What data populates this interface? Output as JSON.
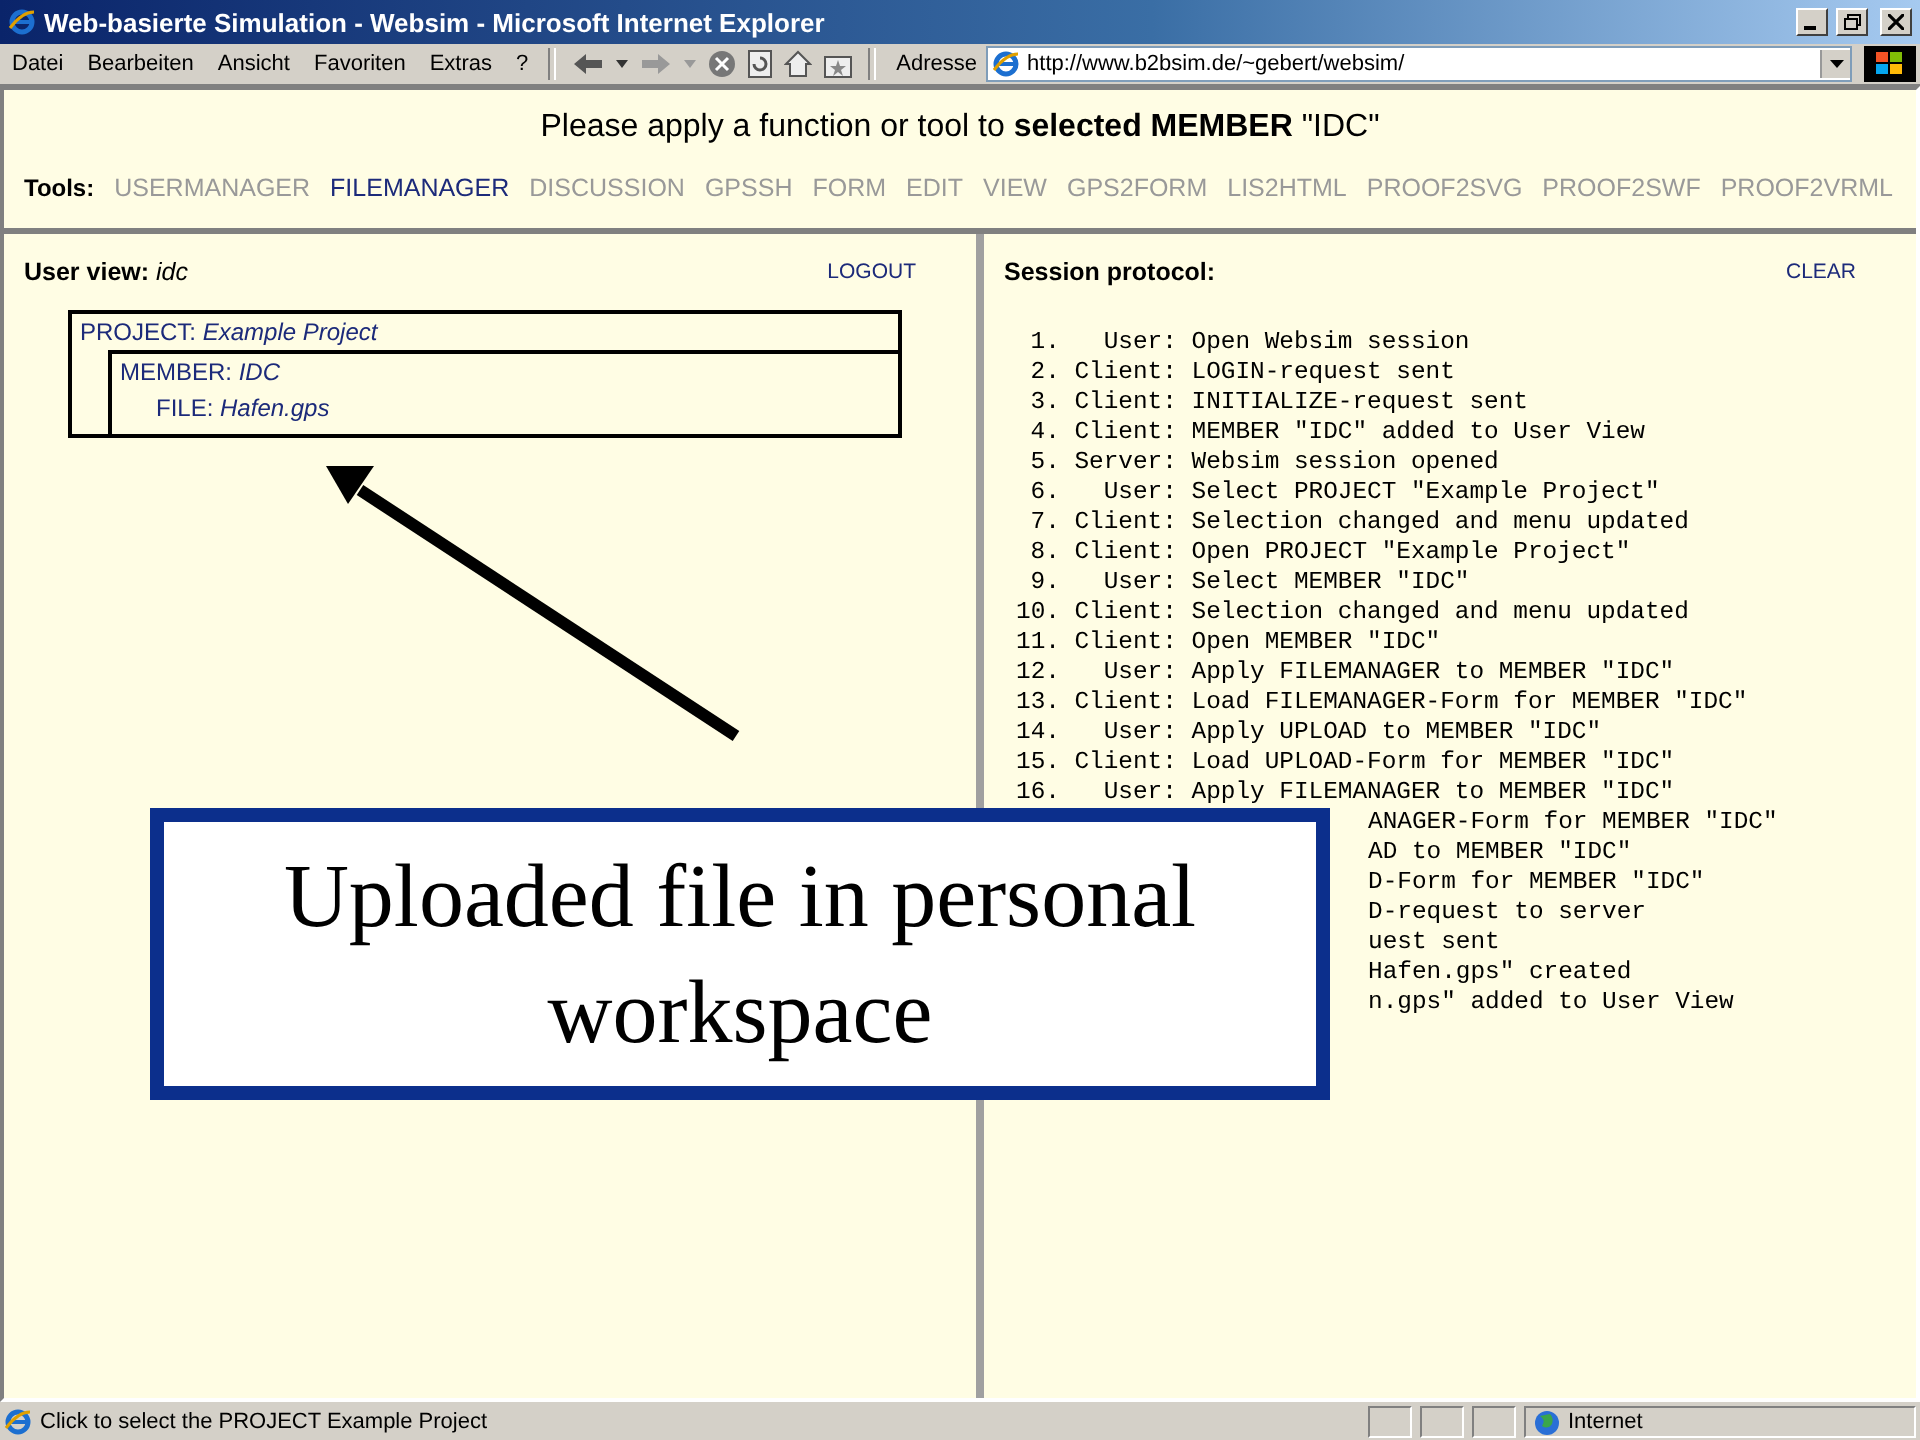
{
  "window": {
    "title": "Web-basierte Simulation - Websim - Microsoft Internet Explorer"
  },
  "menu": [
    "Datei",
    "Bearbeiten",
    "Ansicht",
    "Favoriten",
    "Extras",
    "?"
  ],
  "address": {
    "label": "Adresse",
    "value": "http://www.b2bsim.de/~gebert/websim/"
  },
  "header": {
    "message": "Please apply a function or tool to **selected MEMBER** \"IDC\"",
    "tools_label": "Tools:",
    "tools": [
      {
        "label": "USERMANAGER",
        "selected": false
      },
      {
        "label": "FILEMANAGER",
        "selected": true
      },
      {
        "label": "DISCUSSION",
        "selected": false
      },
      {
        "label": "GPSSH",
        "selected": false
      },
      {
        "label": "FORM",
        "selected": false
      },
      {
        "label": "EDIT",
        "selected": false
      },
      {
        "label": "VIEW",
        "selected": false
      },
      {
        "label": "GPS2FORM",
        "selected": false
      },
      {
        "label": "LIS2HTML",
        "selected": false
      },
      {
        "label": "PROOF2SVG",
        "selected": false
      },
      {
        "label": "PROOF2SWF",
        "selected": false
      },
      {
        "label": "PROOF2VRML",
        "selected": false
      }
    ]
  },
  "user_view": {
    "title": "**User view:** *idc*",
    "logout": "LOGOUT",
    "tree": [
      {
        "label": "PROJECT: *Example Project*",
        "children": [
          {
            "label": "MEMBER: *IDC*",
            "children": [
              {
                "label": "FILE: *Hafen.gps*"
              }
            ]
          }
        ]
      }
    ]
  },
  "session_protocol": {
    "title": "Session protocol:",
    "clear": "CLEAR",
    "lines": [
      {
        "kind": "full",
        "num": "1.",
        "who": "User:",
        "msg": "Open Websim session"
      },
      {
        "kind": "full",
        "num": "2.",
        "who": "Client:",
        "msg": "LOGIN-request sent"
      },
      {
        "kind": "full",
        "num": "3.",
        "who": "Client:",
        "msg": "INITIALIZE-request sent"
      },
      {
        "kind": "full",
        "num": "4.",
        "who": "Client:",
        "msg": "MEMBER \"IDC\" added to User View"
      },
      {
        "kind": "full",
        "num": "5.",
        "who": "Server:",
        "msg": "Websim session opened"
      },
      {
        "kind": "full",
        "num": "6.",
        "who": "User:",
        "msg": "Select PROJECT \"Example Project\""
      },
      {
        "kind": "full",
        "num": "7.",
        "who": "Client:",
        "msg": "Selection changed and menu updated"
      },
      {
        "kind": "full",
        "num": "8.",
        "who": "Client:",
        "msg": "Open PROJECT \"Example Project\""
      },
      {
        "kind": "full",
        "num": "9.",
        "who": "User:",
        "msg": "Select MEMBER \"IDC\""
      },
      {
        "kind": "full",
        "num": "10.",
        "who": "Client:",
        "msg": "Selection changed and menu updated"
      },
      {
        "kind": "full",
        "num": "11.",
        "who": "Client:",
        "msg": "Open MEMBER \"IDC\""
      },
      {
        "kind": "full",
        "num": "12.",
        "who": "User:",
        "msg": "Apply FILEMANAGER to MEMBER \"IDC\""
      },
      {
        "kind": "full",
        "num": "13.",
        "who": "Client:",
        "msg": "Load FILEMANAGER-Form for MEMBER \"IDC\""
      },
      {
        "kind": "full",
        "num": "14.",
        "who": "User:",
        "msg": "Apply UPLOAD to MEMBER \"IDC\""
      },
      {
        "kind": "full",
        "num": "15.",
        "who": "Client:",
        "msg": "Load UPLOAD-Form for MEMBER \"IDC\""
      },
      {
        "kind": "full",
        "num": "16.",
        "who": "User:",
        "msg": "Apply FILEMANAGER to MEMBER \"IDC\""
      },
      {
        "kind": "cut",
        "msg": "ANAGER-Form for MEMBER \"IDC\""
      },
      {
        "kind": "cut",
        "msg": "AD to MEMBER \"IDC\""
      },
      {
        "kind": "cut",
        "msg": "D-Form for MEMBER \"IDC\""
      },
      {
        "kind": "cut",
        "msg": "D-request to server"
      },
      {
        "kind": "cut",
        "msg": "uest sent"
      },
      {
        "kind": "cut",
        "msg": "Hafen.gps\" created"
      },
      {
        "kind": "cut",
        "msg": "n.gps\" added to User View"
      }
    ]
  },
  "callout": {
    "text": "Uploaded file in personal workspace"
  },
  "status_bar": {
    "text": "Click to select the PROJECT Example Project",
    "zone": "Internet"
  }
}
